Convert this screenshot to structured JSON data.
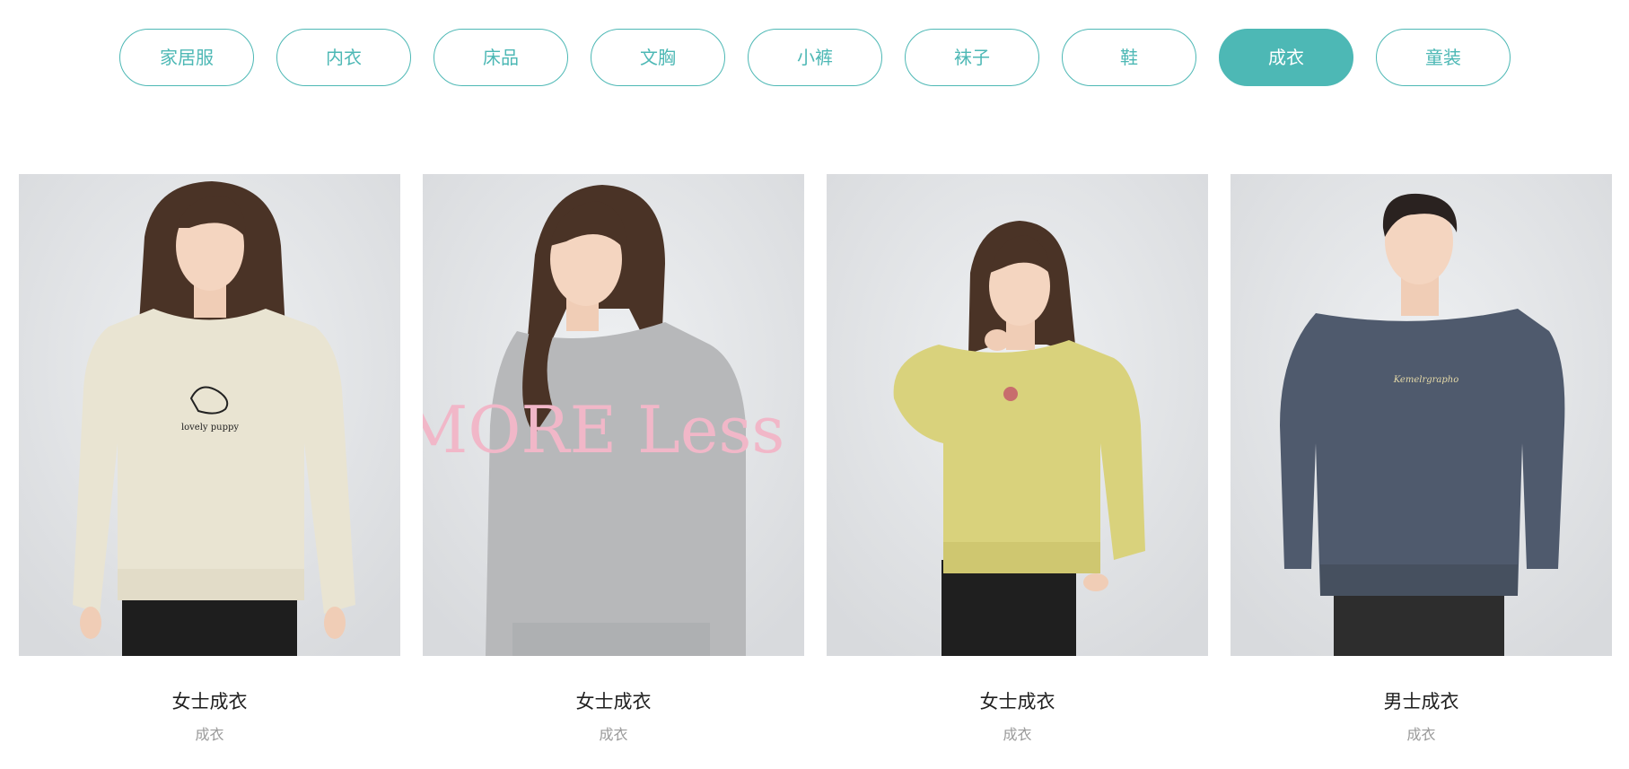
{
  "tabs": [
    {
      "label": "家居服",
      "active": false
    },
    {
      "label": "内衣",
      "active": false
    },
    {
      "label": "床品",
      "active": false
    },
    {
      "label": "文胸",
      "active": false
    },
    {
      "label": "小裤",
      "active": false
    },
    {
      "label": "袜子",
      "active": false
    },
    {
      "label": "鞋",
      "active": false
    },
    {
      "label": "成衣",
      "active": true
    },
    {
      "label": "童装",
      "active": false
    }
  ],
  "accent_color": "#4db8b5",
  "products": [
    {
      "title": "女士成衣",
      "category": "成衣",
      "sweater_color": "#e9e4d2",
      "print_text": "lovely puppy"
    },
    {
      "title": "女士成衣",
      "category": "成衣",
      "sweater_color": "#b7b8ba",
      "print_text": "MORE Less"
    },
    {
      "title": "女士成衣",
      "category": "成衣",
      "sweater_color": "#d9d27c",
      "print_text": ""
    },
    {
      "title": "男士成衣",
      "category": "成衣",
      "sweater_color": "#4f5a6d",
      "print_text": "Kemelrgrapho"
    }
  ]
}
